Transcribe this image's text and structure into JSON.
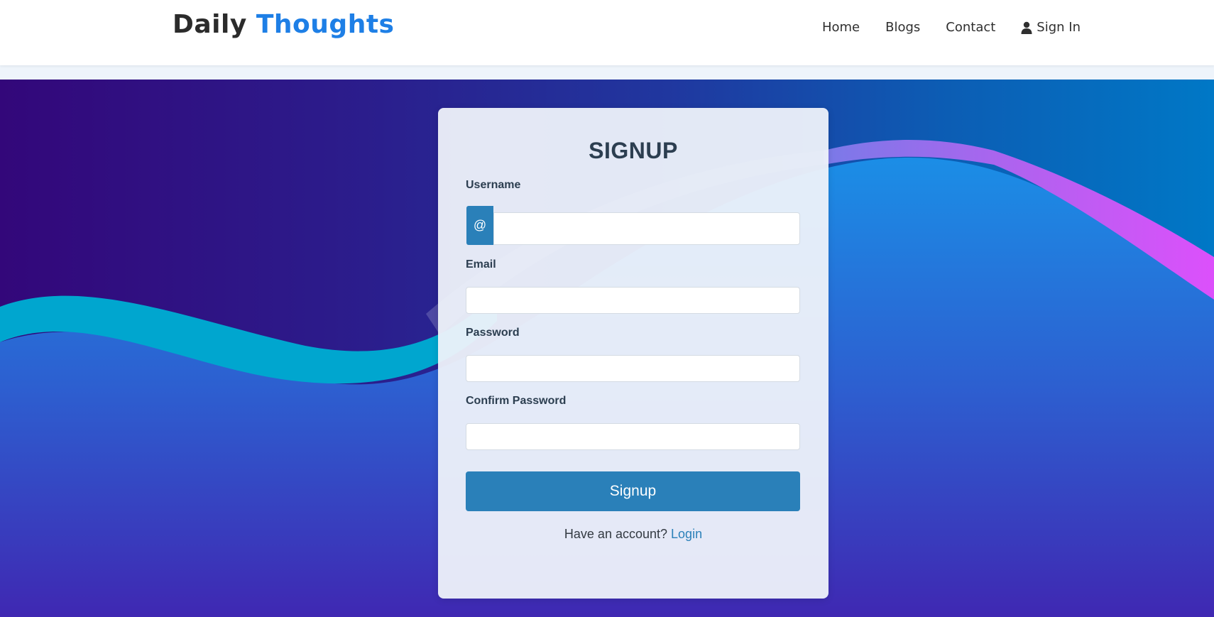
{
  "header": {
    "brand_main": "Daily",
    "brand_accent": "Thoughts",
    "nav": {
      "home": "Home",
      "blogs": "Blogs",
      "contact": "Contact",
      "sign_in": "Sign In"
    },
    "sign_in_icon": "user-icon"
  },
  "form": {
    "title": "SIGNUP",
    "username_label": "Username",
    "username_addon": "@",
    "username_value": "",
    "email_label": "Email",
    "email_value": "",
    "password_label": "Password",
    "password_value": "",
    "confirm_label": "Confirm Password",
    "confirm_value": "",
    "submit_label": "Signup",
    "footer_prompt": "Have an account?",
    "login_link": "Login"
  },
  "colors": {
    "brand_accent": "#1e7fe6",
    "primary_button": "#2a80b9",
    "background_left": "#33077a",
    "background_right": "#0078c6",
    "wave_cyan": "#00a6cf",
    "wave_magenta": "#d34ff5"
  }
}
